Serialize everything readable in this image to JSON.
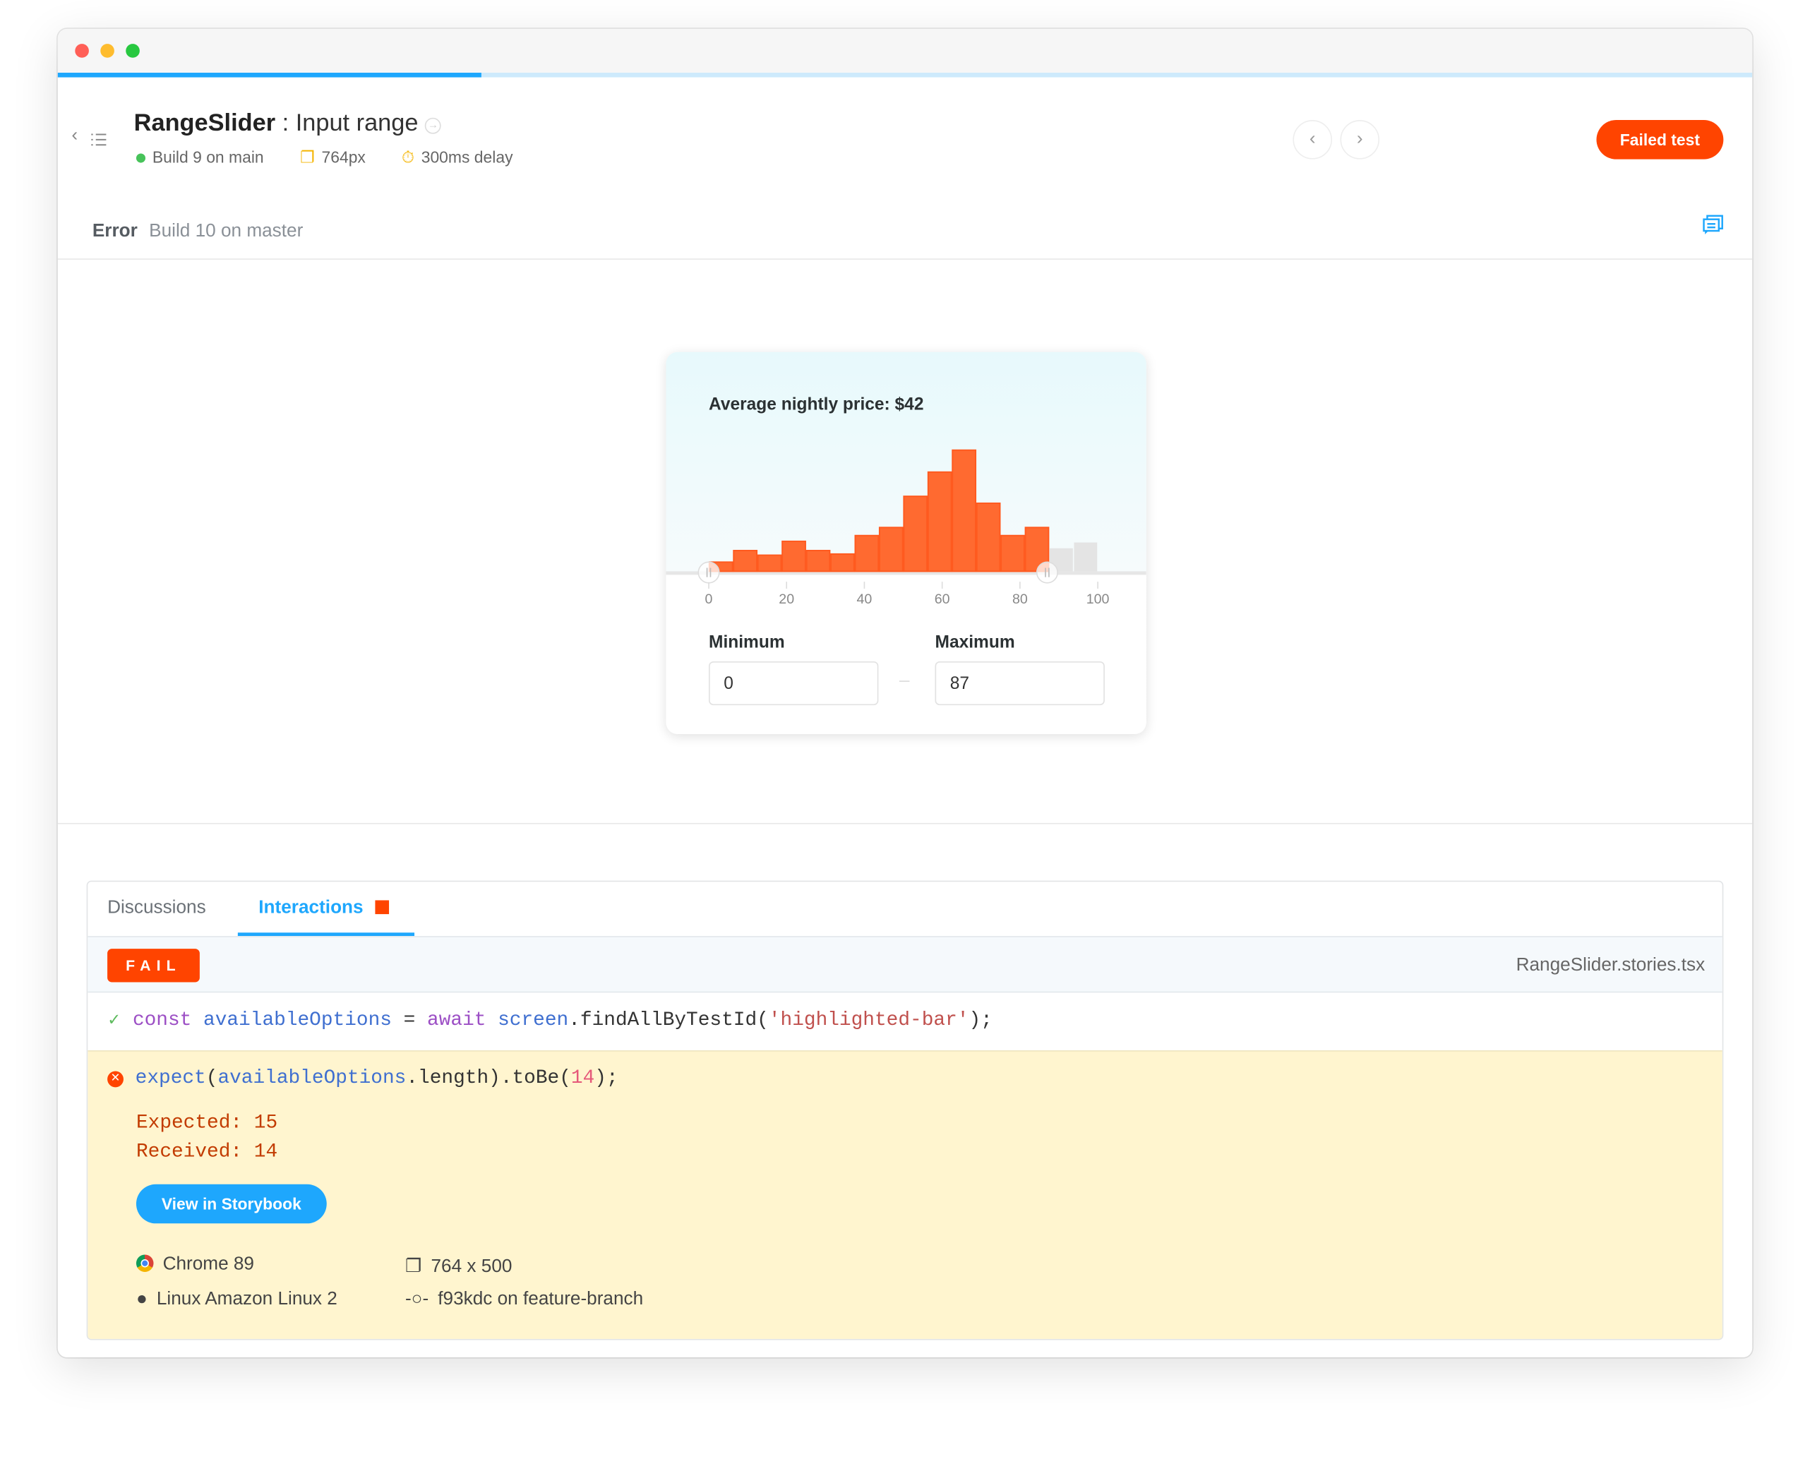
{
  "window": {
    "progress_percent": 25
  },
  "header": {
    "component": "RangeSlider",
    "separator": " : ",
    "story": "Input range",
    "build": "Build 9 on main",
    "viewport": "764px",
    "delay": "300ms delay",
    "failed_button": "Failed test"
  },
  "status": {
    "label": "Error",
    "build": "Build 10 on master"
  },
  "preview": {
    "title": "Average nightly price: $42",
    "min_label": "Minimum",
    "max_label": "Maximum",
    "min_value": "0",
    "max_value": "87",
    "range_dash": "–"
  },
  "chart_data": {
    "type": "bar",
    "title": "Average nightly price: $42",
    "x_ticks": [
      0,
      20,
      40,
      60,
      80,
      100
    ],
    "xlim": [
      0,
      100
    ],
    "bin_width": 6.25,
    "bins": [
      0,
      6.25,
      12.5,
      18.75,
      25,
      31.25,
      37.5,
      43.75,
      50,
      56.25,
      62.5,
      68.75,
      75,
      81.25,
      87.5,
      93.75
    ],
    "values": [
      8,
      18,
      14,
      26,
      18,
      15,
      31,
      38,
      65,
      86,
      105,
      59,
      31,
      38,
      20,
      25
    ],
    "selected_range": [
      0,
      87
    ],
    "highlight_color": "#ff6a30",
    "inactive_color": "#e4e4e4"
  },
  "panel": {
    "tabs": [
      {
        "label": "Discussions"
      },
      {
        "label": "Interactions"
      }
    ],
    "fail_badge": "FAIL",
    "file": "RangeSlider.stories.tsx",
    "line1": {
      "kw1": "const",
      "var": "availableOptions",
      "eq": " = ",
      "kw2": "await",
      "obj": "screen",
      "call": ".findAllByTestId(",
      "str": "'highlighted-bar'",
      "end": ");"
    },
    "line2": {
      "fn": "expect",
      "p1": "(",
      "var": "availableOptions",
      "rest": ".length).toBe(",
      "num": "14",
      "end": ");"
    },
    "expected": "Expected: 15",
    "received": "Received: 14",
    "storybook_button": "View in Storybook",
    "browser": "Chrome 89",
    "os": "Linux Amazon Linux 2",
    "size": "764 x 500",
    "commit": "f93kdc on feature-branch"
  },
  "colors": {
    "accent": "#1ea7fd",
    "fail": "#ff4400",
    "error_bg": "#fff5cf"
  }
}
